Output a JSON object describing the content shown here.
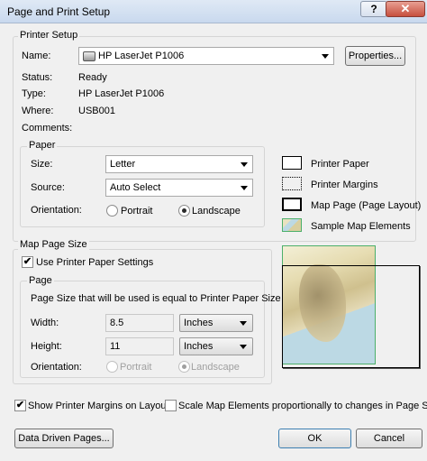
{
  "window": {
    "title": "Page and Print Setup",
    "help_glyph": "?",
    "close_glyph": "✕"
  },
  "printer_setup": {
    "legend": "Printer Setup",
    "name_label": "Name:",
    "name_value": "HP LaserJet P1006",
    "properties_label": "Properties...",
    "status_label": "Status:",
    "status_value": "Ready",
    "type_label": "Type:",
    "type_value": "HP LaserJet P1006",
    "where_label": "Where:",
    "where_value": "USB001",
    "comments_label": "Comments:"
  },
  "paper": {
    "legend": "Paper",
    "size_label": "Size:",
    "size_value": "Letter",
    "source_label": "Source:",
    "source_value": "Auto Select",
    "orientation_label": "Orientation:",
    "portrait_label": "Portrait",
    "landscape_label": "Landscape",
    "selected_orientation": "Landscape"
  },
  "legend_panel": {
    "printer_paper": "Printer Paper",
    "printer_margins": "Printer Margins",
    "map_page": "Map Page (Page Layout)",
    "sample_map": "Sample Map Elements"
  },
  "map_page_size": {
    "legend": "Map Page Size",
    "use_printer_settings_label": "Use Printer Paper Settings",
    "use_printer_settings_checked": true,
    "page_legend": "Page",
    "page_info": "Page Size that will be used is equal to Printer Paper Size",
    "width_label": "Width:",
    "width_value": "8.5",
    "width_unit": "Inches",
    "height_label": "Height:",
    "height_value": "11",
    "height_unit": "Inches",
    "orientation_label": "Orientation:",
    "portrait_label": "Portrait",
    "landscape_label": "Landscape"
  },
  "bottom": {
    "show_margins_label": "Show Printer Margins on Layout",
    "show_margins_checked": true,
    "scale_label": "Scale Map Elements proportionally to changes in Page Size",
    "scale_checked": false,
    "data_driven_label": "Data Driven Pages...",
    "ok_label": "OK",
    "cancel_label": "Cancel"
  },
  "colors": {
    "map_border": "#4caf6a",
    "map_water": "#bcd9e4",
    "check_mark": "✔"
  }
}
